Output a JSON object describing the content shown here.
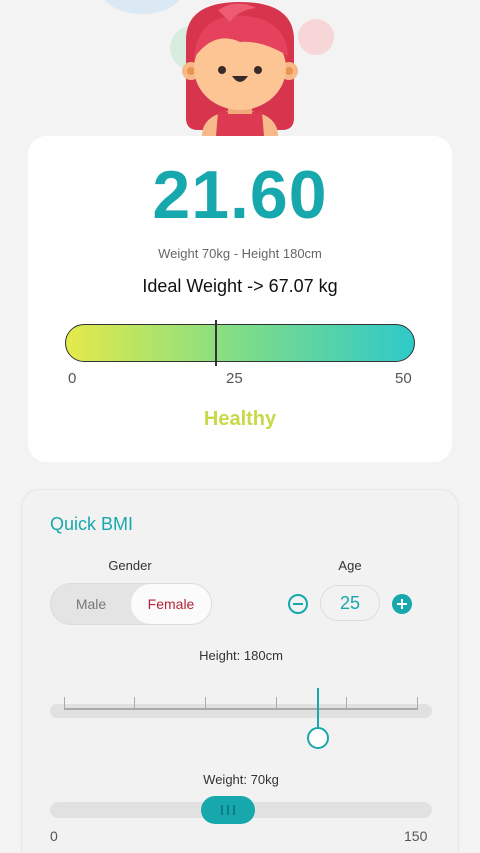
{
  "result": {
    "bmi": "21.60",
    "measurements": "Weight 70kg - Height 180cm",
    "ideal_weight": "Ideal Weight -> 67.07 kg",
    "category": "Healthy",
    "category_color": "#c8d846",
    "scale": {
      "min_label": "0",
      "mid_label": "25",
      "max_label": "50",
      "min": 0,
      "max": 50,
      "value": 21.6
    }
  },
  "quick_bmi": {
    "title": "Quick BMI",
    "gender": {
      "label": "Gender",
      "options": [
        "Male",
        "Female"
      ],
      "selected": "Female"
    },
    "age": {
      "label": "Age",
      "value": "25"
    },
    "height": {
      "label": "Height: 180cm",
      "value_cm": 180
    },
    "weight": {
      "label": "Weight: 70kg",
      "min_label": "0",
      "max_label": "150",
      "value_kg": 70
    }
  },
  "colors": {
    "accent": "#17a8ad",
    "female": "#b3253a",
    "background": "#f3f3f3"
  },
  "icons": {
    "hero": "girl-avatar-illustration",
    "age_decrement": "minus-circle-icon",
    "age_increment": "plus-circle-icon",
    "slider_grip": "grip-lines-icon"
  }
}
